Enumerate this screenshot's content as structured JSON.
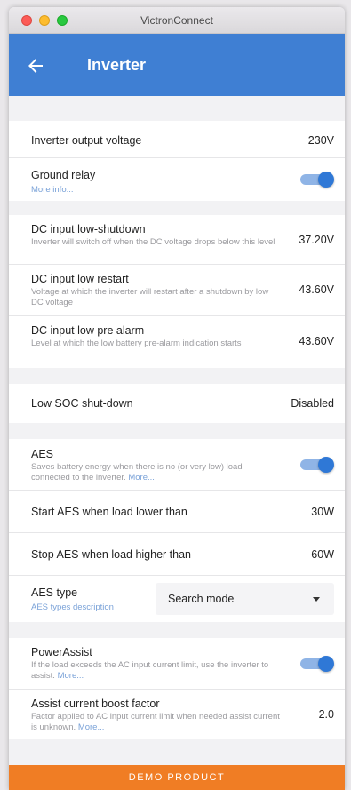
{
  "window": {
    "title": "VictronConnect"
  },
  "appbar": {
    "title": "Inverter"
  },
  "settings": {
    "output_voltage": {
      "label": "Inverter output voltage",
      "value": "230V"
    },
    "ground_relay": {
      "label": "Ground relay",
      "link": "More info...",
      "state": true
    },
    "dc_low_shutdown": {
      "label": "DC input low-shutdown",
      "desc": "Inverter will switch off when the DC voltage drops below this level",
      "value": "37.20V"
    },
    "dc_low_restart": {
      "label": "DC input low restart",
      "desc": "Voltage at which the inverter will restart after a shutdown by low DC voltage",
      "value": "43.60V"
    },
    "dc_low_prealarm": {
      "label": "DC input low pre alarm",
      "desc": "Level at which the low battery pre-alarm indication starts",
      "value": "43.60V"
    },
    "low_soc_shutdown": {
      "label": "Low SOC shut-down",
      "value": "Disabled"
    },
    "aes": {
      "label": "AES",
      "desc": "Saves battery energy when there is no (or very low) load connected to the inverter.",
      "link": "More...",
      "state": true
    },
    "aes_start": {
      "label": "Start AES when load lower than",
      "value": "30W"
    },
    "aes_stop": {
      "label": "Stop AES when load higher than",
      "value": "60W"
    },
    "aes_type": {
      "label": "AES type",
      "link": "AES types description",
      "selected": "Search mode"
    },
    "power_assist": {
      "label": "PowerAssist",
      "desc": "If the load exceeds the AC input current limit, use the inverter to assist.",
      "link": "More...",
      "state": true
    },
    "boost_factor": {
      "label": "Assist current boost factor",
      "desc": "Factor applied to AC input current limit when needed assist current is unknown.",
      "link": "More...",
      "value": "2.0"
    }
  },
  "footer": {
    "banner": "DEMO PRODUCT"
  },
  "colors": {
    "accent": "#3f7fd3",
    "toggle_on": "#2f78d6",
    "banner": "#f07d24"
  }
}
